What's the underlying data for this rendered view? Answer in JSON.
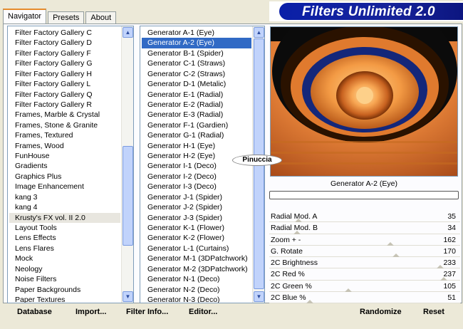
{
  "window": {
    "title": "Filters Unlimited 2.0"
  },
  "tabs": [
    {
      "label": "Navigator",
      "active": true
    },
    {
      "label": "Presets",
      "active": false
    },
    {
      "label": "About",
      "active": false
    }
  ],
  "categories": [
    "Filter Factory Gallery C",
    "Filter Factory Gallery D",
    "Filter Factory Gallery F",
    "Filter Factory Gallery G",
    "Filter Factory Gallery H",
    "Filter Factory Gallery L",
    "Filter Factory Gallery Q",
    "Filter Factory Gallery R",
    "Frames, Marble & Crystal",
    "Frames, Stone & Granite",
    "Frames, Textured",
    "Frames, Wood",
    "FunHouse",
    "Gradients",
    "Graphics Plus",
    "Image Enhancement",
    "kang 3",
    "kang 4",
    "Krusty's FX vol. II 2.0",
    "Layout Tools",
    "Lens Effects",
    "Lens Flares",
    "Mock",
    "Neology",
    "Noise Filters",
    "Paper Backgrounds",
    "Paper Textures"
  ],
  "selected_category": "Krusty's FX vol. II 2.0",
  "filters": [
    "Generator A-1 (Eye)",
    "Generator A-2 (Eye)",
    "Generator B-1 (Spider)",
    "Generator C-1 (Straws)",
    "Generator C-2 (Straws)",
    "Generator D-1 (Metalic)",
    "Generator E-1 (Radial)",
    "Generator E-2 (Radial)",
    "Generator E-3 (Radial)",
    "Generator F-1 (Gardien)",
    "Generator G-1 (Radial)",
    "Generator H-1 (Eye)",
    "Generator H-2 (Eye)",
    "Generator I-1 (Deco)",
    "Generator I-2 (Deco)",
    "Generator I-3 (Deco)",
    "Generator J-1 (Spider)",
    "Generator J-2 (Spider)",
    "Generator J-3 (Spider)",
    "Generator K-1 (Flower)",
    "Generator K-2 (Flower)",
    "Generator L-1 (Curtains)",
    "Generator M-1 (3DPatchwork)",
    "Generator M-2 (3DPatchwork)",
    "Generator N-1 (Deco)",
    "Generator N-2 (Deco)",
    "Generator N-3 (Deco)"
  ],
  "selected_filter": "Generator A-2 (Eye)",
  "preview": {
    "label": "Generator A-2 (Eye)",
    "watermark": "Pinuccia"
  },
  "sliders": [
    {
      "label": "Radial Mod. A",
      "value": "35",
      "level": 0.14
    },
    {
      "label": "Radial Mod. B",
      "value": "34",
      "level": 0.13
    },
    {
      "label": "Zoom + -",
      "value": "162",
      "level": 0.64
    },
    {
      "label": "G. Rotate",
      "value": "170",
      "level": 0.67
    },
    {
      "label": "2C Brightness",
      "value": "233",
      "level": 0.91
    },
    {
      "label": "2C Red %",
      "value": "237",
      "level": 0.93
    },
    {
      "label": "2C Green %",
      "value": "105",
      "level": 0.41
    },
    {
      "label": "2C Blue %",
      "value": "51",
      "level": 0.2
    }
  ],
  "buttons": {
    "database": "Database",
    "import": "Import...",
    "filter_info": "Filter Info...",
    "editor": "Editor...",
    "randomize": "Randomize",
    "reset": "Reset"
  }
}
